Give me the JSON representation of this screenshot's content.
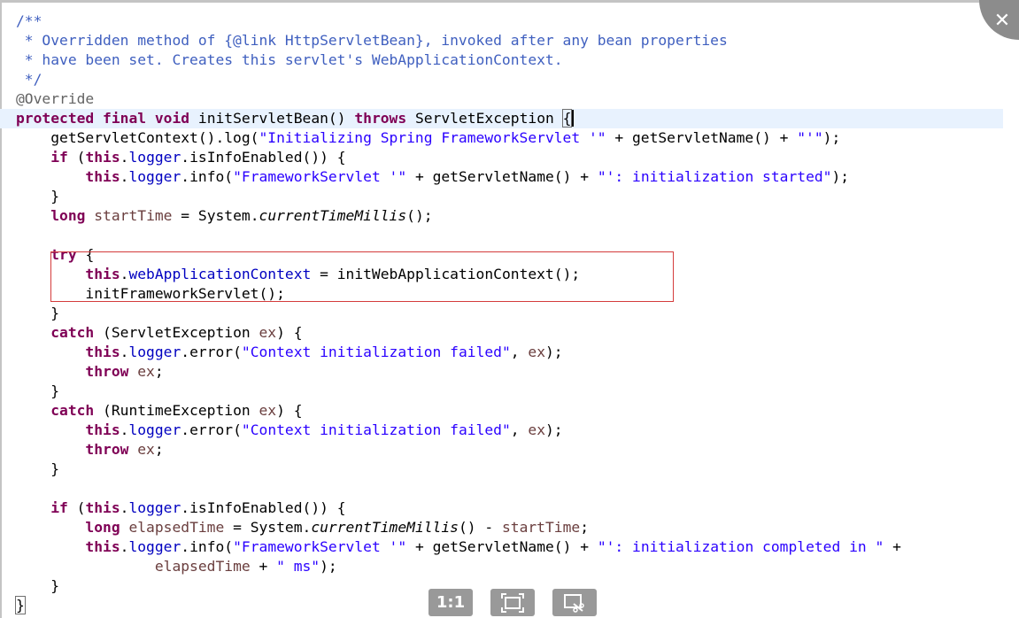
{
  "code_lines": [
    [
      {
        "t": "/**",
        "c": "comment"
      }
    ],
    [
      {
        "t": " * Overridden method of {@link HttpServletBean}, invoked after any bean properties",
        "c": "comment"
      }
    ],
    [
      {
        "t": " * have been set. Creates this servlet's WebApplicationContext.",
        "c": "comment"
      }
    ],
    [
      {
        "t": " */",
        "c": "comment"
      }
    ],
    [
      {
        "t": "@Override",
        "c": "annotation"
      }
    ],
    [
      {
        "t": "protected",
        "c": "kw"
      },
      {
        "t": " "
      },
      {
        "t": "final",
        "c": "kw"
      },
      {
        "t": " "
      },
      {
        "t": "void",
        "c": "kw"
      },
      {
        "t": " initServletBean() "
      },
      {
        "t": "throws",
        "c": "kw"
      },
      {
        "t": " ServletException "
      },
      {
        "t": "{",
        "c": "bracket-box"
      },
      {
        "t": "",
        "c": "cursor"
      }
    ],
    [
      {
        "t": "    getServletContext().log("
      },
      {
        "t": "\"Initializing Spring FrameworkServlet '\"",
        "c": "str"
      },
      {
        "t": " + getServletName() + "
      },
      {
        "t": "\"'\"",
        "c": "str"
      },
      {
        "t": ");"
      }
    ],
    [
      {
        "t": "    "
      },
      {
        "t": "if",
        "c": "kw"
      },
      {
        "t": " ("
      },
      {
        "t": "this",
        "c": "kw"
      },
      {
        "t": "."
      },
      {
        "t": "logger",
        "c": "field"
      },
      {
        "t": ".isInfoEnabled()) {"
      }
    ],
    [
      {
        "t": "        "
      },
      {
        "t": "this",
        "c": "kw"
      },
      {
        "t": "."
      },
      {
        "t": "logger",
        "c": "field"
      },
      {
        "t": ".info("
      },
      {
        "t": "\"FrameworkServlet '\"",
        "c": "str"
      },
      {
        "t": " + getServletName() + "
      },
      {
        "t": "\"': initialization started\"",
        "c": "str"
      },
      {
        "t": ");"
      }
    ],
    [
      {
        "t": "    }"
      }
    ],
    [
      {
        "t": "    "
      },
      {
        "t": "long",
        "c": "kw"
      },
      {
        "t": " "
      },
      {
        "t": "startTime",
        "c": "var"
      },
      {
        "t": " = System."
      },
      {
        "t": "currentTimeMillis",
        "c": "static-m"
      },
      {
        "t": "();"
      }
    ],
    [
      {
        "t": ""
      }
    ],
    [
      {
        "t": "    "
      },
      {
        "t": "try",
        "c": "kw"
      },
      {
        "t": " {"
      }
    ],
    [
      {
        "t": "        "
      },
      {
        "t": "this",
        "c": "kw"
      },
      {
        "t": "."
      },
      {
        "t": "webApplicationContext",
        "c": "field"
      },
      {
        "t": " = initWebApplicationContext();"
      }
    ],
    [
      {
        "t": "        initFrameworkServlet();"
      }
    ],
    [
      {
        "t": "    }"
      }
    ],
    [
      {
        "t": "    "
      },
      {
        "t": "catch",
        "c": "kw"
      },
      {
        "t": " (ServletException "
      },
      {
        "t": "ex",
        "c": "var"
      },
      {
        "t": ") {"
      }
    ],
    [
      {
        "t": "        "
      },
      {
        "t": "this",
        "c": "kw"
      },
      {
        "t": "."
      },
      {
        "t": "logger",
        "c": "field"
      },
      {
        "t": ".error("
      },
      {
        "t": "\"Context initialization failed\"",
        "c": "str"
      },
      {
        "t": ", "
      },
      {
        "t": "ex",
        "c": "var"
      },
      {
        "t": ");"
      }
    ],
    [
      {
        "t": "        "
      },
      {
        "t": "throw",
        "c": "kw"
      },
      {
        "t": " "
      },
      {
        "t": "ex",
        "c": "var"
      },
      {
        "t": ";"
      }
    ],
    [
      {
        "t": "    }"
      }
    ],
    [
      {
        "t": "    "
      },
      {
        "t": "catch",
        "c": "kw"
      },
      {
        "t": " (RuntimeException "
      },
      {
        "t": "ex",
        "c": "var"
      },
      {
        "t": ") {"
      }
    ],
    [
      {
        "t": "        "
      },
      {
        "t": "this",
        "c": "kw"
      },
      {
        "t": "."
      },
      {
        "t": "logger",
        "c": "field"
      },
      {
        "t": ".error("
      },
      {
        "t": "\"Context initialization failed\"",
        "c": "str"
      },
      {
        "t": ", "
      },
      {
        "t": "ex",
        "c": "var"
      },
      {
        "t": ");"
      }
    ],
    [
      {
        "t": "        "
      },
      {
        "t": "throw",
        "c": "kw"
      },
      {
        "t": " "
      },
      {
        "t": "ex",
        "c": "var"
      },
      {
        "t": ";"
      }
    ],
    [
      {
        "t": "    }"
      }
    ],
    [
      {
        "t": ""
      }
    ],
    [
      {
        "t": "    "
      },
      {
        "t": "if",
        "c": "kw"
      },
      {
        "t": " ("
      },
      {
        "t": "this",
        "c": "kw"
      },
      {
        "t": "."
      },
      {
        "t": "logger",
        "c": "field"
      },
      {
        "t": ".isInfoEnabled()) {"
      }
    ],
    [
      {
        "t": "        "
      },
      {
        "t": "long",
        "c": "kw"
      },
      {
        "t": " "
      },
      {
        "t": "elapsedTime",
        "c": "var"
      },
      {
        "t": " = System."
      },
      {
        "t": "currentTimeMillis",
        "c": "static-m"
      },
      {
        "t": "() - "
      },
      {
        "t": "startTime",
        "c": "var"
      },
      {
        "t": ";"
      }
    ],
    [
      {
        "t": "        "
      },
      {
        "t": "this",
        "c": "kw"
      },
      {
        "t": "."
      },
      {
        "t": "logger",
        "c": "field"
      },
      {
        "t": ".info("
      },
      {
        "t": "\"FrameworkServlet '\"",
        "c": "str"
      },
      {
        "t": " + getServletName() + "
      },
      {
        "t": "\"': initialization completed in \"",
        "c": "str"
      },
      {
        "t": " +"
      }
    ],
    [
      {
        "t": "                "
      },
      {
        "t": "elapsedTime",
        "c": "var"
      },
      {
        "t": " + "
      },
      {
        "t": "\" ms\"",
        "c": "str"
      },
      {
        "t": ");"
      }
    ],
    [
      {
        "t": "    }"
      }
    ],
    [
      {
        "t": "}",
        "c": "bracket-box"
      }
    ]
  ],
  "current_line": 5,
  "close": {
    "label": "✕"
  },
  "toolbar": {
    "actual_size_label": "1:1",
    "fit_icon": "fit-screen-icon",
    "crop_icon": "crop-edit-icon"
  },
  "colors": {
    "comment": "#3f5fbf",
    "keyword": "#7f0055",
    "string": "#2a00ff",
    "field": "#0000c0",
    "local_variable": "#6a3e3e",
    "annotation": "#646464",
    "highlight_box": "#d43b3b",
    "current_line_bg": "#e8f2fe",
    "toolbar_button": "#999999"
  }
}
